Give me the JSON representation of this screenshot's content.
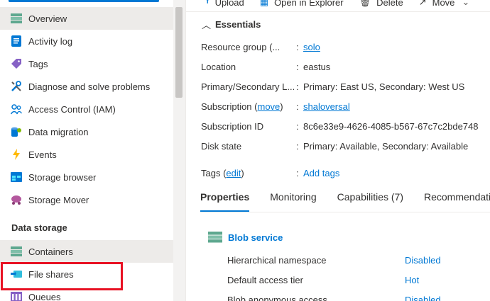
{
  "sidebar": {
    "items": [
      {
        "label": "Overview",
        "icon": "overview-icon"
      },
      {
        "label": "Activity log",
        "icon": "activity-log-icon"
      },
      {
        "label": "Tags",
        "icon": "tag-icon"
      },
      {
        "label": "Diagnose and solve problems",
        "icon": "wrench-icon"
      },
      {
        "label": "Access Control (IAM)",
        "icon": "people-icon"
      },
      {
        "label": "Data migration",
        "icon": "data-migration-icon"
      },
      {
        "label": "Events",
        "icon": "lightning-icon"
      },
      {
        "label": "Storage browser",
        "icon": "storage-browser-icon"
      },
      {
        "label": "Storage Mover",
        "icon": "storage-mover-icon"
      }
    ],
    "section_title": "Data storage",
    "data_items": [
      {
        "label": "Containers",
        "icon": "containers-icon"
      },
      {
        "label": "File shares",
        "icon": "file-shares-icon"
      },
      {
        "label": "Queues",
        "icon": "queues-icon"
      }
    ]
  },
  "toolbar": {
    "upload": "Upload",
    "open_in_explorer": "Open in Explorer",
    "delete": "Delete",
    "move": "Move"
  },
  "essentials": {
    "title": "Essentials",
    "rows": [
      {
        "key": "Resource group (...",
        "value": "solo"
      },
      {
        "key": "Location",
        "value": "eastus"
      },
      {
        "key": "Primary/Secondary L...",
        "value": "Primary: East US, Secondary: West US"
      },
      {
        "key": "Subscription (",
        "key_link": "move",
        "key_end": ")",
        "value": "shaloversal"
      },
      {
        "key": "Subscription ID",
        "value": "8c6e33e9-4626-4085-b567-67c7c2bde748"
      },
      {
        "key": "Disk state",
        "value": "Primary: Available, Secondary: Available"
      }
    ],
    "tags_key": "Tags (",
    "tags_link": "edit",
    "tags_end": ")",
    "tags_value": "Add tags"
  },
  "tabs": [
    "Properties",
    "Monitoring",
    "Capabilities (7)",
    "Recommendations"
  ],
  "blob": {
    "title": "Blob service",
    "rows": [
      {
        "key": "Hierarchical namespace",
        "value": "Disabled"
      },
      {
        "key": "Default access tier",
        "value": "Hot"
      },
      {
        "key": "Blob anonymous access",
        "value": "Disabled"
      }
    ]
  },
  "colors": {
    "accent": "#0078d4",
    "highlight": "#e81123",
    "active_bg": "#edebe9"
  }
}
